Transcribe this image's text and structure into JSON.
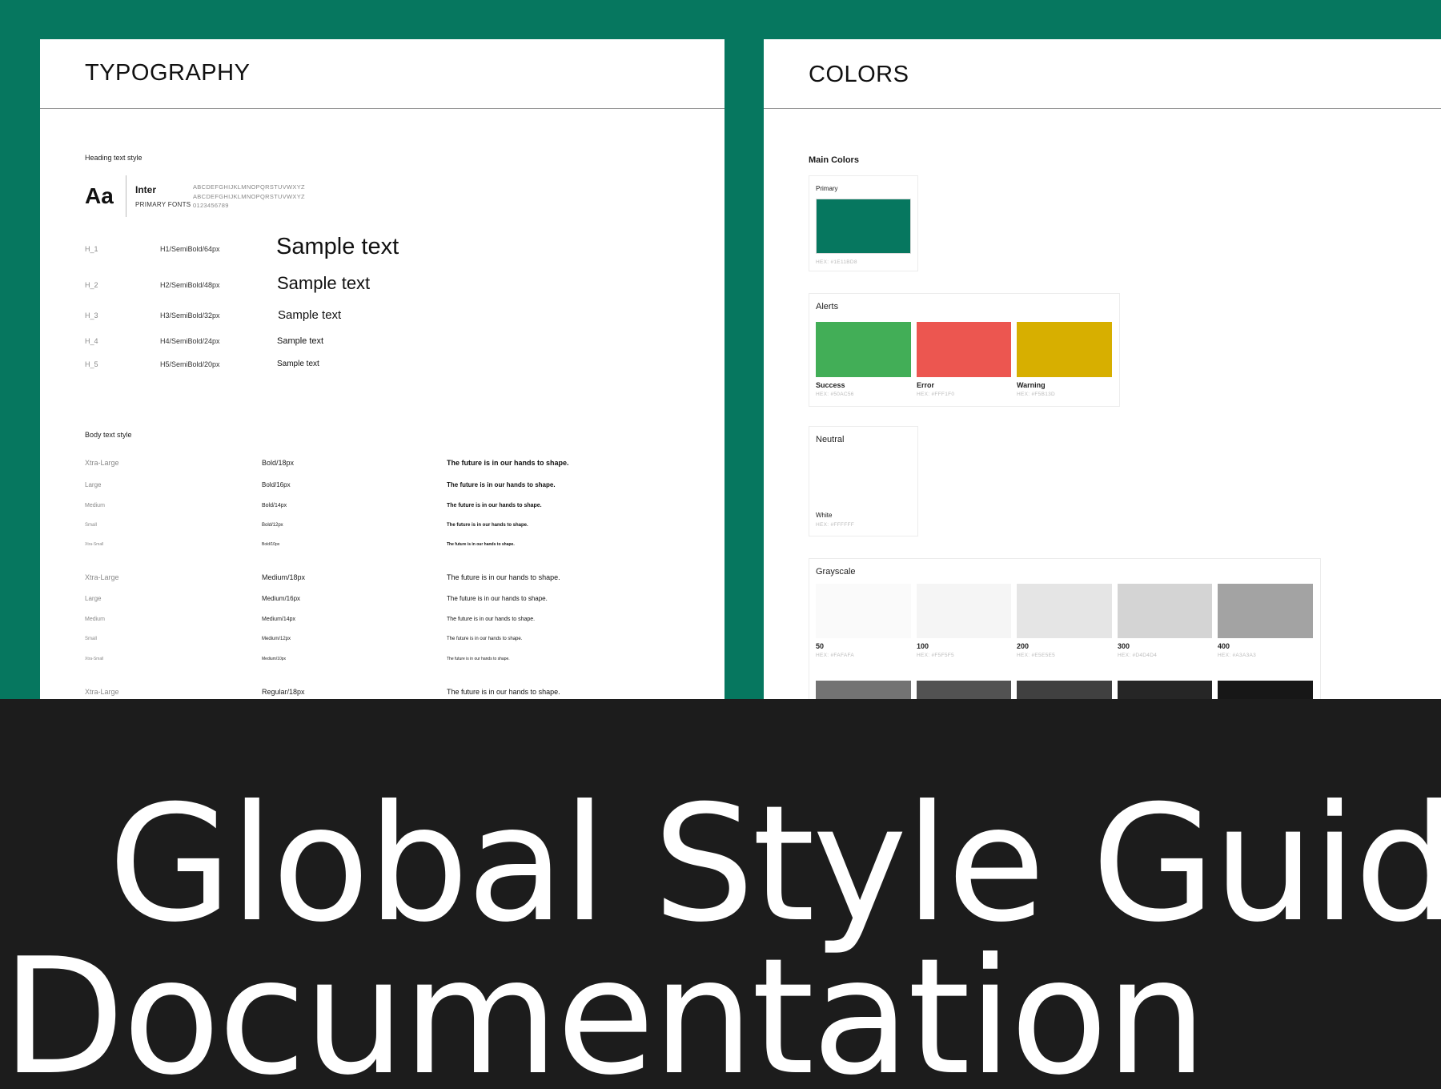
{
  "typography": {
    "title": "TYPOGRAPHY",
    "heading_section_label": "Heading text style",
    "font_sample": "Aa",
    "font_name": "Inter",
    "font_role": "PRIMARY FONTS",
    "glyph_upper": "ABCDEFGHIJKLMNOPQRSTUVWXYZ",
    "glyph_lower": "ABCDEFGHIJKLMNOPQRSTUVWXYZ",
    "glyph_digits": "0123456789",
    "headings": [
      {
        "tag": "H_1",
        "spec": "H1/SemiBold/64px",
        "sample": "Sample text"
      },
      {
        "tag": "H_2",
        "spec": "H2/SemiBold/48px",
        "sample": "Sample text"
      },
      {
        "tag": "H_3",
        "spec": "H3/SemiBold/32px",
        "sample": "Sample text"
      },
      {
        "tag": "H_4",
        "spec": "H4/SemiBold/24px",
        "sample": "Sample text"
      },
      {
        "tag": "H_5",
        "spec": "H5/SemiBold/20px",
        "sample": "Sample text"
      }
    ],
    "body_section_label": "Body text style",
    "body_rows": [
      {
        "size": "Xtra-Large",
        "spec": "Bold/18px",
        "sample": "The future is in our hands to shape."
      },
      {
        "size": "Large",
        "spec": "Bold/16px",
        "sample": "The future is in our hands to shape."
      },
      {
        "size": "Medium",
        "spec": "Bold/14px",
        "sample": "The future is in our hands to shape."
      },
      {
        "size": "Small",
        "spec": "Bold/12px",
        "sample": "The future is in our hands to shape."
      },
      {
        "size": "Xtra-Small",
        "spec": "Bold/10px",
        "sample": "The future is in our hands to shape."
      },
      {
        "size": "Xtra-Large",
        "spec": "Medium/18px",
        "sample": "The future is in our hands to shape."
      },
      {
        "size": "Large",
        "spec": "Medium/16px",
        "sample": "The future is in our hands to shape."
      },
      {
        "size": "Medium",
        "spec": "Medium/14px",
        "sample": "The future is in our hands to shape."
      },
      {
        "size": "Small",
        "spec": "Medium/12px",
        "sample": "The future is in our hands to shape."
      },
      {
        "size": "Xtra-Small",
        "spec": "Medium/10px",
        "sample": "The future is in our hands to shape."
      },
      {
        "size": "Xtra-Large",
        "spec": "Regular/18px",
        "sample": "The future is in our hands to shape."
      }
    ]
  },
  "colors": {
    "title": "COLORS",
    "main_label": "Main Colors",
    "primary": {
      "label": "Primary",
      "hex_label": "HEX: #1E11BD8",
      "color": "#06775F"
    },
    "alerts_label": "Alerts",
    "alerts": [
      {
        "name": "Success",
        "hex_label": "HEX: #50AC56",
        "color": "#42AE57"
      },
      {
        "name": "Error",
        "hex_label": "HEX: #FFF1F0",
        "color": "#EC5650"
      },
      {
        "name": "Warning",
        "hex_label": "HEX: #F5B13D",
        "color": "#D7AF00"
      }
    ],
    "neutral_label": "Neutral",
    "neutral": {
      "name": "White",
      "hex_label": "HEX: #FFFFFF",
      "color": "#FFFFFF"
    },
    "grayscale_label": "Grayscale",
    "grayscale": [
      {
        "name": "50",
        "hex_label": "HEX: #FAFAFA",
        "color": "#FAFAFA"
      },
      {
        "name": "100",
        "hex_label": "HEX: #F5F5F5",
        "color": "#F5F5F5"
      },
      {
        "name": "200",
        "hex_label": "HEX: #E5E5E5",
        "color": "#E5E5E5"
      },
      {
        "name": "300",
        "hex_label": "HEX: #D4D4D4",
        "color": "#D4D4D4"
      },
      {
        "name": "400",
        "hex_label": "HEX: #A3A3A3",
        "color": "#A3A3A3"
      }
    ],
    "grayscale_dark": [
      "#737373",
      "#525252",
      "#404040",
      "#262626",
      "#171717"
    ]
  },
  "headline": {
    "line1": "Global Style Guide",
    "line2": "Documentation"
  },
  "theme": {
    "brand_green": "#06775F",
    "dark_band": "#1C1C1C"
  }
}
